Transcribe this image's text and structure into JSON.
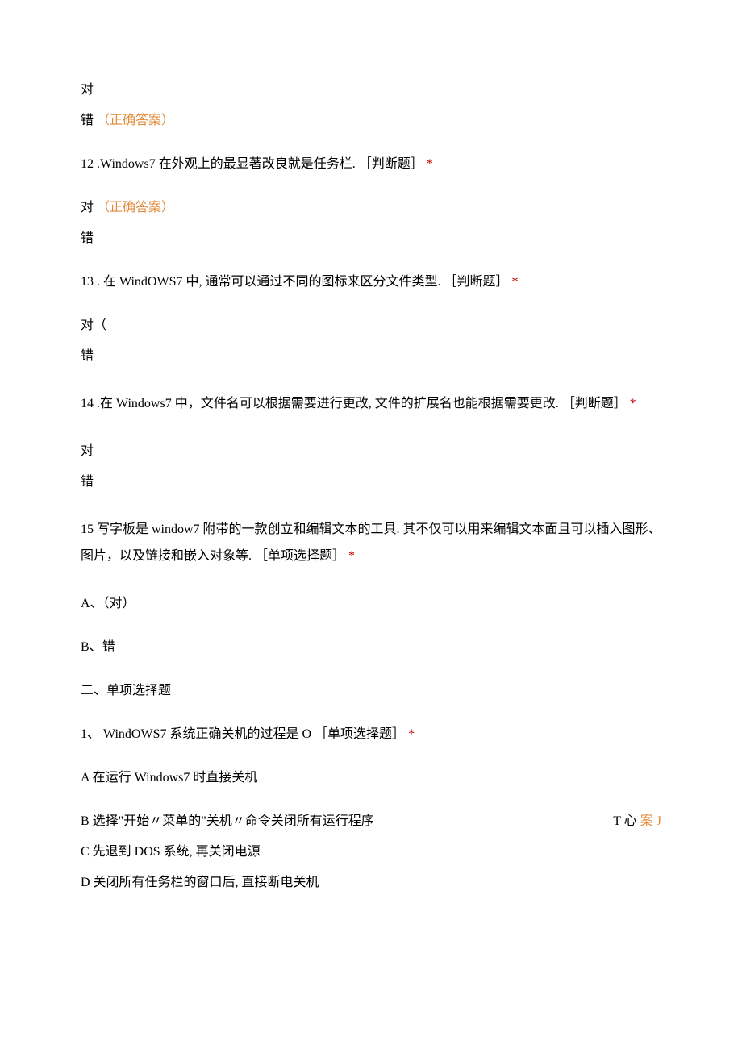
{
  "labels": {
    "correct": "对",
    "wrong": "错",
    "correct_answer_paren": "（正确答案）",
    "asterisk": "*",
    "judge_tag": "［判断题］",
    "single_tag": "［单项选择题］"
  },
  "q11": {
    "opt_a": "对",
    "opt_b_prefix": "错"
  },
  "q12": {
    "num": "12 ",
    "text": ".Windows7 在外观上的最显著改良就是任务栏.",
    "opt_a_prefix": "对",
    "opt_b": "错"
  },
  "q13": {
    "num": "13 ",
    "text": ". 在 WindOWS7 中, 通常可以通过不同的图标来区分文件类型.",
    "opt_a": "对（",
    "opt_b": "错"
  },
  "q14": {
    "num": "14 ",
    "text": ".在 Windows7 中，文件名可以根据需要进行更改, 文件的扩展名也能根据需要更改.",
    "opt_a": "对",
    "opt_b": "错"
  },
  "q15": {
    "num": "15 ",
    "text": "写字板是 window7 附带的一款创立和编辑文本的工具. 其不仅可以用来编辑文本面且可以插入图形、图片，以及链接和嵌入对象等.",
    "opt_a": "A、（对）",
    "opt_b": "B、错"
  },
  "section2": {
    "title": "二、单项选择题"
  },
  "s2q1": {
    "num": "1、",
    "text": "WindOWS7 系统正确关机的过程是 O",
    "opt_a": "A 在运行 Windows7 时直接关机",
    "opt_b": "B 选择\"开始〃菜单的\"关机〃命令关闭所有运行程序",
    "opt_b_tail_black": "T 心",
    "opt_b_tail_orange": "案 J",
    "opt_c": "C 先退到 DOS 系统, 再关闭电源",
    "opt_d": "D 关闭所有任务栏的窗口后, 直接断电关机"
  }
}
